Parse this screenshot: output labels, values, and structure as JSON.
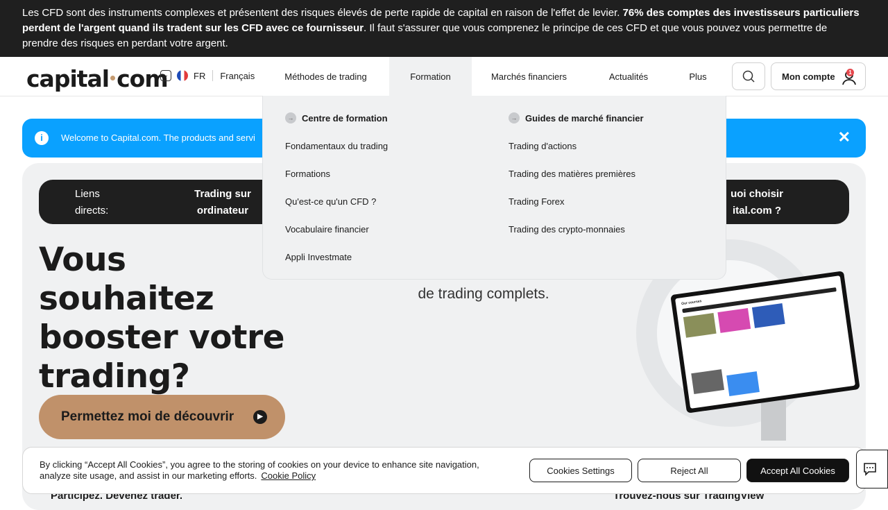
{
  "risk_banner": {
    "part1": "Les CFD sont des instruments complexes et présentent des risques élevés de perte rapide de capital en raison de l'effet de levier. ",
    "bold": "76% des comptes des investisseurs particuliers perdent de l'argent quand ils tradent sur les CFD avec ce fournisseur",
    "part2": ". Il faut s'assurer que vous comprenez le principe de ces CFD et que vous pouvez vous permettre de prendre des risques en perdant votre argent."
  },
  "header": {
    "logo_left": "capital",
    "logo_right": "com",
    "lang_code": "FR",
    "lang_name": "Français",
    "menu": [
      {
        "label": "Méthodes de trading"
      },
      {
        "label": "Formation"
      },
      {
        "label": "Marchés financiers"
      },
      {
        "label": "Actualités"
      },
      {
        "label": "Plus"
      }
    ],
    "account_label": "Mon compte",
    "account_badge": "1"
  },
  "dropdown": {
    "col1_title": "Centre de formation",
    "col1_items": [
      "Fondamentaux du trading",
      "Formations",
      "Qu'est-ce qu'un CFD ?",
      "Vocabulaire financier",
      "Appli Investmate"
    ],
    "col2_title": "Guides de marché financier",
    "col2_items": [
      "Trading d'actions",
      "Trading des matières premières",
      "Trading Forex",
      "Trading des crypto-monnaies"
    ]
  },
  "welcome": {
    "text": "Welcome to Capital.com. The products and servi"
  },
  "hero": {
    "quick_label": "Liens directs:",
    "quick_link1": "Trading sur ordinateur",
    "quick_link2": "uoi choisir ital.com ?",
    "headline": "Vous souhaitez booster votre trading?",
    "subtext": "de trading complets.",
    "cta": "Permettez moi de découvrir",
    "screen_title": "Our courses"
  },
  "cookie": {
    "text": "By clicking “Accept All Cookies”, you agree to the storing of cookies on your device to enhance site navigation, analyze site usage, and assist in our marketing efforts.",
    "policy": "Cookie Policy",
    "settings": "Cookies Settings",
    "reject": "Reject All",
    "accept": "Accept All Cookies"
  },
  "peek": {
    "left": "Participez. Devenez trader.",
    "right": "Trouvez-nous sur TradingView"
  }
}
